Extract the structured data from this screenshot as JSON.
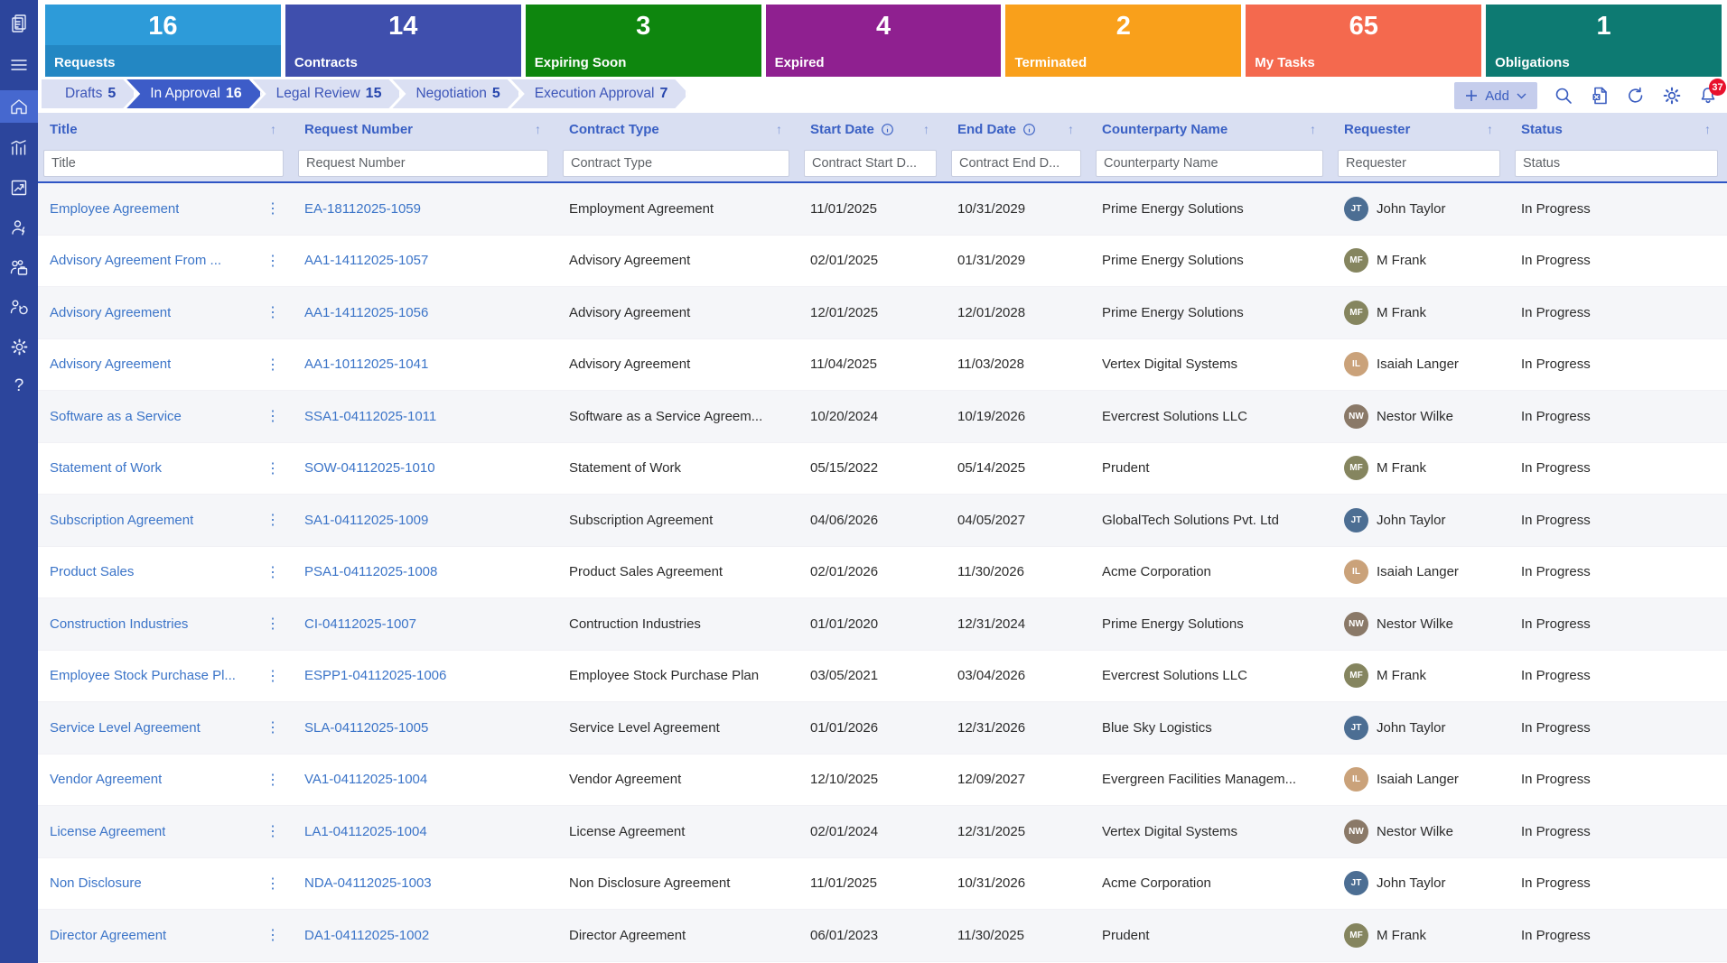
{
  "colors": {
    "sidebar_bg": "#2c459c",
    "sidebar_active": "#4668cf",
    "header_bg": "#d9dff2",
    "accent_blue": "#3a5dc0",
    "link_blue": "#3b74c8",
    "active_stage": "#3d5cc8",
    "badge_red": "#e8112d"
  },
  "sidebar": {
    "items": [
      {
        "name": "app-logo-icon"
      },
      {
        "name": "menu-icon"
      },
      {
        "name": "home-icon",
        "active": true
      },
      {
        "name": "dashboard-chart-icon"
      },
      {
        "name": "trend-chart-icon"
      },
      {
        "name": "user-admin-icon"
      },
      {
        "name": "team-briefcase-icon"
      },
      {
        "name": "team-sync-icon"
      },
      {
        "name": "settings-icon"
      },
      {
        "name": "help-icon",
        "glyph": "?"
      }
    ]
  },
  "cards": [
    {
      "label": "Requests",
      "count": "16",
      "color": "#2d9bd9",
      "color2": "#2387c3"
    },
    {
      "label": "Contracts",
      "count": "14",
      "color": "#3f4fad"
    },
    {
      "label": "Expiring Soon",
      "count": "3",
      "color": "#0e860e"
    },
    {
      "label": "Expired",
      "count": "4",
      "color": "#8f2090"
    },
    {
      "label": "Terminated",
      "count": "2",
      "color": "#f9a01b"
    },
    {
      "label": "My Tasks",
      "count": "65",
      "color": "#f4694e"
    },
    {
      "label": "Obligations",
      "count": "1",
      "color": "#0d7a72"
    }
  ],
  "workflow": {
    "stages": [
      {
        "label": "Drafts",
        "count": "5",
        "active": false
      },
      {
        "label": "In Approval",
        "count": "16",
        "active": true
      },
      {
        "label": "Legal Review",
        "count": "15",
        "active": false
      },
      {
        "label": "Negotiation",
        "count": "5",
        "active": false
      },
      {
        "label": "Execution Approval",
        "count": "7",
        "active": false
      }
    ]
  },
  "toolbar": {
    "add_label": "Add",
    "notification_count": "37",
    "icons": [
      "add-icon",
      "chevron-down-icon",
      "search-icon",
      "excel-export-icon",
      "refresh-icon",
      "settings-icon",
      "notifications-bell-icon"
    ]
  },
  "table": {
    "columns": [
      {
        "label": "Title",
        "placeholder": "Title"
      },
      {
        "label": "Request Number",
        "placeholder": "Request Number"
      },
      {
        "label": "Contract Type",
        "placeholder": "Contract Type"
      },
      {
        "label": "Start Date",
        "placeholder": "Contract Start D...",
        "info": true
      },
      {
        "label": "End Date",
        "placeholder": "Contract End D...",
        "info": true
      },
      {
        "label": "Counterparty Name",
        "placeholder": "Counterparty Name"
      },
      {
        "label": "Requester",
        "placeholder": "Requester"
      },
      {
        "label": "Status",
        "placeholder": "Status"
      }
    ],
    "rows": [
      {
        "title": "Employee Agreement",
        "request_number": "EA-18112025-1059",
        "contract_type": "Employment Agreement",
        "start_date": "11/01/2025",
        "end_date": "10/31/2029",
        "counterparty": "Prime Energy Solutions",
        "requester": "John Taylor",
        "initials": "JT",
        "avatar_color": "#4c6e93",
        "status": "In Progress"
      },
      {
        "title": "Advisory Agreement From ...",
        "request_number": "AA1-14112025-1057",
        "contract_type": "Advisory Agreement",
        "start_date": "02/01/2025",
        "end_date": "01/31/2029",
        "counterparty": "Prime Energy Solutions",
        "requester": "M Frank",
        "initials": "MF",
        "avatar_color": "#85855f",
        "status": "In Progress"
      },
      {
        "title": "Advisory Agreement",
        "request_number": "AA1-14112025-1056",
        "contract_type": "Advisory Agreement",
        "start_date": "12/01/2025",
        "end_date": "12/01/2028",
        "counterparty": "Prime Energy Solutions",
        "requester": "M Frank",
        "initials": "MF",
        "avatar_color": "#85855f",
        "status": "In Progress"
      },
      {
        "title": "Advisory Agreement",
        "request_number": "AA1-10112025-1041",
        "contract_type": "Advisory Agreement",
        "start_date": "11/04/2025",
        "end_date": "11/03/2028",
        "counterparty": "Vertex Digital Systems",
        "requester": "Isaiah Langer",
        "initials": "IL",
        "avatar_color": "#caa27a",
        "status": "In Progress"
      },
      {
        "title": "Software as a Service",
        "request_number": "SSA1-04112025-1011",
        "contract_type": "Software as a Service Agreem...",
        "start_date": "10/20/2024",
        "end_date": "10/19/2026",
        "counterparty": "Evercrest Solutions LLC",
        "requester": "Nestor Wilke",
        "initials": "NW",
        "avatar_color": "#8a7968",
        "status": "In Progress"
      },
      {
        "title": "Statement of Work",
        "request_number": "SOW-04112025-1010",
        "contract_type": "Statement of Work",
        "start_date": "05/15/2022",
        "end_date": "05/14/2025",
        "counterparty": "Prudent",
        "requester": "M Frank",
        "initials": "MF",
        "avatar_color": "#85855f",
        "status": "In Progress"
      },
      {
        "title": "Subscription Agreement",
        "request_number": "SA1-04112025-1009",
        "contract_type": "Subscription Agreement",
        "start_date": "04/06/2026",
        "end_date": "04/05/2027",
        "counterparty": "GlobalTech Solutions Pvt. Ltd",
        "requester": "John Taylor",
        "initials": "JT",
        "avatar_color": "#4c6e93",
        "status": "In Progress"
      },
      {
        "title": "Product Sales",
        "request_number": "PSA1-04112025-1008",
        "contract_type": "Product Sales Agreement",
        "start_date": "02/01/2026",
        "end_date": "11/30/2026",
        "counterparty": "Acme Corporation",
        "requester": "Isaiah Langer",
        "initials": "IL",
        "avatar_color": "#caa27a",
        "status": "In Progress"
      },
      {
        "title": "Construction Industries",
        "request_number": "CI-04112025-1007",
        "contract_type": "Contruction Industries",
        "start_date": "01/01/2020",
        "end_date": "12/31/2024",
        "counterparty": "Prime Energy Solutions",
        "requester": "Nestor Wilke",
        "initials": "NW",
        "avatar_color": "#8a7968",
        "status": "In Progress"
      },
      {
        "title": "Employee Stock Purchase Pl...",
        "request_number": "ESPP1-04112025-1006",
        "contract_type": "Employee Stock Purchase Plan",
        "start_date": "03/05/2021",
        "end_date": "03/04/2026",
        "counterparty": "Evercrest Solutions LLC",
        "requester": "M Frank",
        "initials": "MF",
        "avatar_color": "#85855f",
        "status": "In Progress"
      },
      {
        "title": "Service Level Agreement",
        "request_number": "SLA-04112025-1005",
        "contract_type": "Service Level Agreement",
        "start_date": "01/01/2026",
        "end_date": "12/31/2026",
        "counterparty": "Blue Sky Logistics",
        "requester": "John Taylor",
        "initials": "JT",
        "avatar_color": "#4c6e93",
        "status": "In Progress"
      },
      {
        "title": "Vendor Agreement",
        "request_number": "VA1-04112025-1004",
        "contract_type": "Vendor Agreement",
        "start_date": "12/10/2025",
        "end_date": "12/09/2027",
        "counterparty": "Evergreen Facilities Managem...",
        "requester": "Isaiah Langer",
        "initials": "IL",
        "avatar_color": "#caa27a",
        "status": "In Progress"
      },
      {
        "title": "License Agreement",
        "request_number": "LA1-04112025-1004",
        "contract_type": "License Agreement",
        "start_date": "02/01/2024",
        "end_date": "12/31/2025",
        "counterparty": "Vertex Digital Systems",
        "requester": "Nestor Wilke",
        "initials": "NW",
        "avatar_color": "#8a7968",
        "status": "In Progress"
      },
      {
        "title": "Non Disclosure",
        "request_number": "NDA-04112025-1003",
        "contract_type": "Non Disclosure Agreement",
        "start_date": "11/01/2025",
        "end_date": "10/31/2026",
        "counterparty": "Acme Corporation",
        "requester": "John Taylor",
        "initials": "JT",
        "avatar_color": "#4c6e93",
        "status": "In Progress"
      },
      {
        "title": "Director Agreement",
        "request_number": "DA1-04112025-1002",
        "contract_type": "Director Agreement",
        "start_date": "06/01/2023",
        "end_date": "11/30/2025",
        "counterparty": "Prudent",
        "requester": "M Frank",
        "initials": "MF",
        "avatar_color": "#85855f",
        "status": "In Progress"
      }
    ]
  }
}
